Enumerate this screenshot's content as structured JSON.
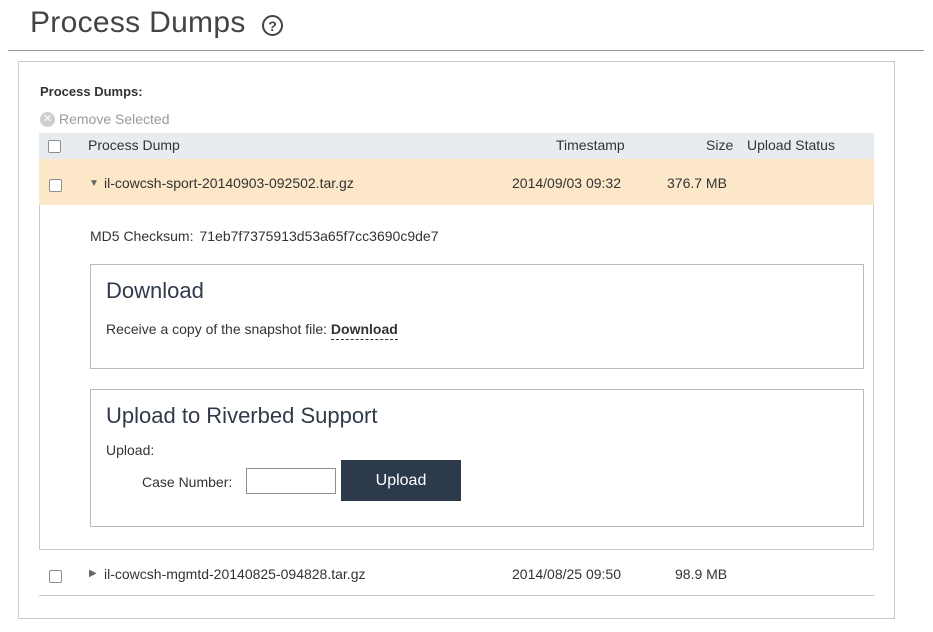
{
  "page": {
    "title": "Process Dumps",
    "help_glyph": "?"
  },
  "panel": {
    "section_label": "Process Dumps:",
    "remove_selected": "Remove Selected"
  },
  "table": {
    "columns": {
      "process_dump": "Process Dump",
      "timestamp": "Timestamp",
      "size": "Size",
      "upload_status": "Upload Status"
    },
    "rows": [
      {
        "name": "il-cowcsh-sport-20140903-092502.tar.gz",
        "timestamp": "2014/09/03 09:32",
        "size": "376.7 MB",
        "upload_status": "",
        "expanded": true,
        "selected": true
      },
      {
        "name": "il-cowcsh-mgmtd-20140825-094828.tar.gz",
        "timestamp": "2014/08/25 09:50",
        "size": "98.9 MB",
        "upload_status": "",
        "expanded": false,
        "selected": false
      }
    ]
  },
  "details": {
    "md5_label": "MD5 Checksum:",
    "md5_value": "71eb7f7375913d53a65f7cc3690c9de7",
    "download": {
      "title": "Download",
      "text": "Receive a copy of the snapshot file:",
      "link": "Download"
    },
    "upload": {
      "title": "Upload to Riverbed Support",
      "upload_label": "Upload:",
      "case_number_label": "Case Number:",
      "case_number_value": "",
      "button": "Upload"
    }
  },
  "icons": {
    "help": "help-icon",
    "remove": "remove-icon",
    "expanded_caret": "caret-down-icon",
    "collapsed_caret": "caret-right-icon"
  },
  "colors": {
    "selected_row": "#fde7c9",
    "table_header": "#e9ecef",
    "upload_button": "#2c3a4c"
  }
}
